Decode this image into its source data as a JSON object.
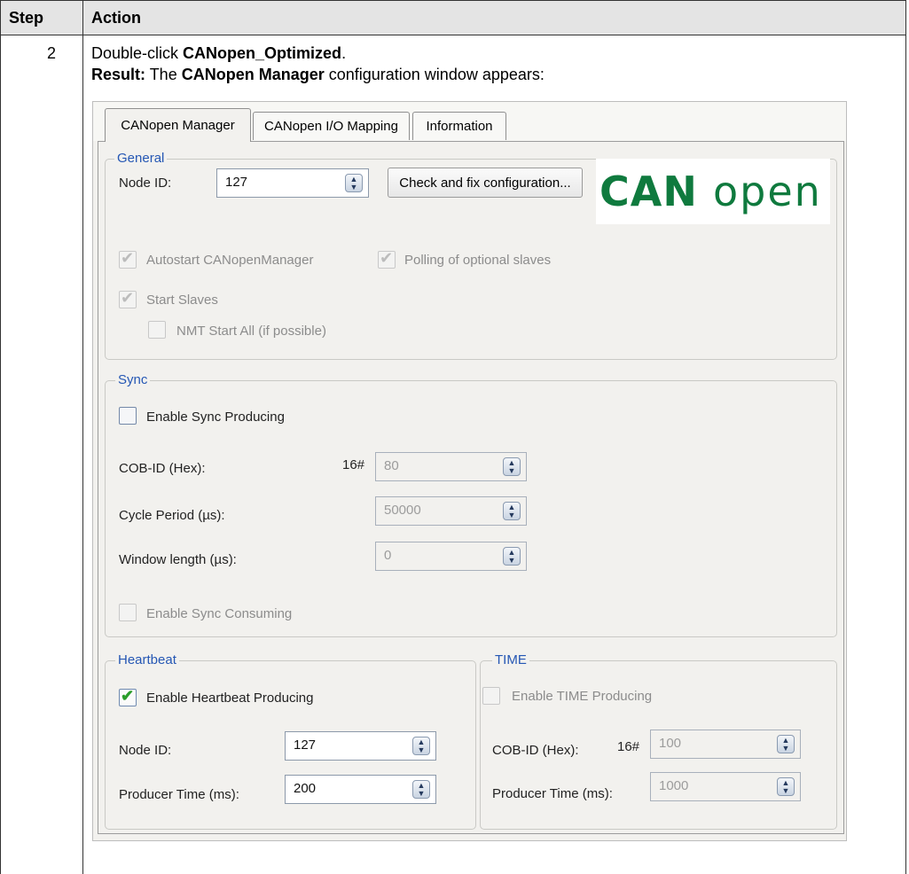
{
  "table": {
    "header_step": "Step",
    "header_action": "Action",
    "step_number": "2",
    "line1_prefix": "Double-click ",
    "line1_bold": "CANopen_Optimized",
    "line1_suffix": ".",
    "line2_bold1": "Result:",
    "line2_mid": " The ",
    "line2_bold2": "CANopen Manager",
    "line2_suffix": " configuration window appears:"
  },
  "tabs": [
    {
      "label": "CANopen Manager",
      "active": true
    },
    {
      "label": "CANopen I/O Mapping",
      "active": false
    },
    {
      "label": "Information",
      "active": false
    }
  ],
  "general": {
    "legend": "General",
    "node_id_label": "Node ID:",
    "node_id_value": "127",
    "check_button": "Check and fix configuration...",
    "logo_bold": "CAN",
    "logo_light": "open",
    "autostart": {
      "label": "Autostart CANopenManager",
      "checked": true,
      "enabled": false
    },
    "polling": {
      "label": "Polling of optional slaves",
      "checked": true,
      "enabled": false
    },
    "start_slaves": {
      "label": "Start Slaves",
      "checked": true,
      "enabled": false
    },
    "nmt_start_all": {
      "label": "NMT Start All (if possible)",
      "checked": false,
      "enabled": false
    }
  },
  "sync": {
    "legend": "Sync",
    "enable_producing": {
      "label": "Enable Sync Producing",
      "checked": false
    },
    "cob_id_label": "COB-ID (Hex):",
    "cob_id_prefix": "16#",
    "cob_id_value": "80",
    "cycle_label": "Cycle Period (µs):",
    "cycle_value": "50000",
    "window_label": "Window length (µs):",
    "window_value": "0",
    "enable_consuming": {
      "label": "Enable Sync Consuming",
      "checked": false,
      "enabled": false
    }
  },
  "heartbeat": {
    "legend": "Heartbeat",
    "enable_producing": {
      "label": "Enable Heartbeat Producing",
      "checked": true
    },
    "node_id_label": "Node ID:",
    "node_id_value": "127",
    "producer_label": "Producer Time (ms):",
    "producer_value": "200"
  },
  "time": {
    "legend": "TIME",
    "enable_producing": {
      "label": "Enable TIME Producing",
      "checked": false,
      "enabled": false
    },
    "cob_id_label": "COB-ID (Hex):",
    "cob_id_prefix": "16#",
    "cob_id_value": "100",
    "producer_label": "Producer Time (ms):",
    "producer_value": "1000"
  },
  "icons": {
    "check_mark": "✔",
    "spin_arrows": "▲▼"
  },
  "colors": {
    "legend_blue": "#2557b4",
    "logo_green": "#0f7a3e",
    "check_green": "#2a9d2a"
  }
}
